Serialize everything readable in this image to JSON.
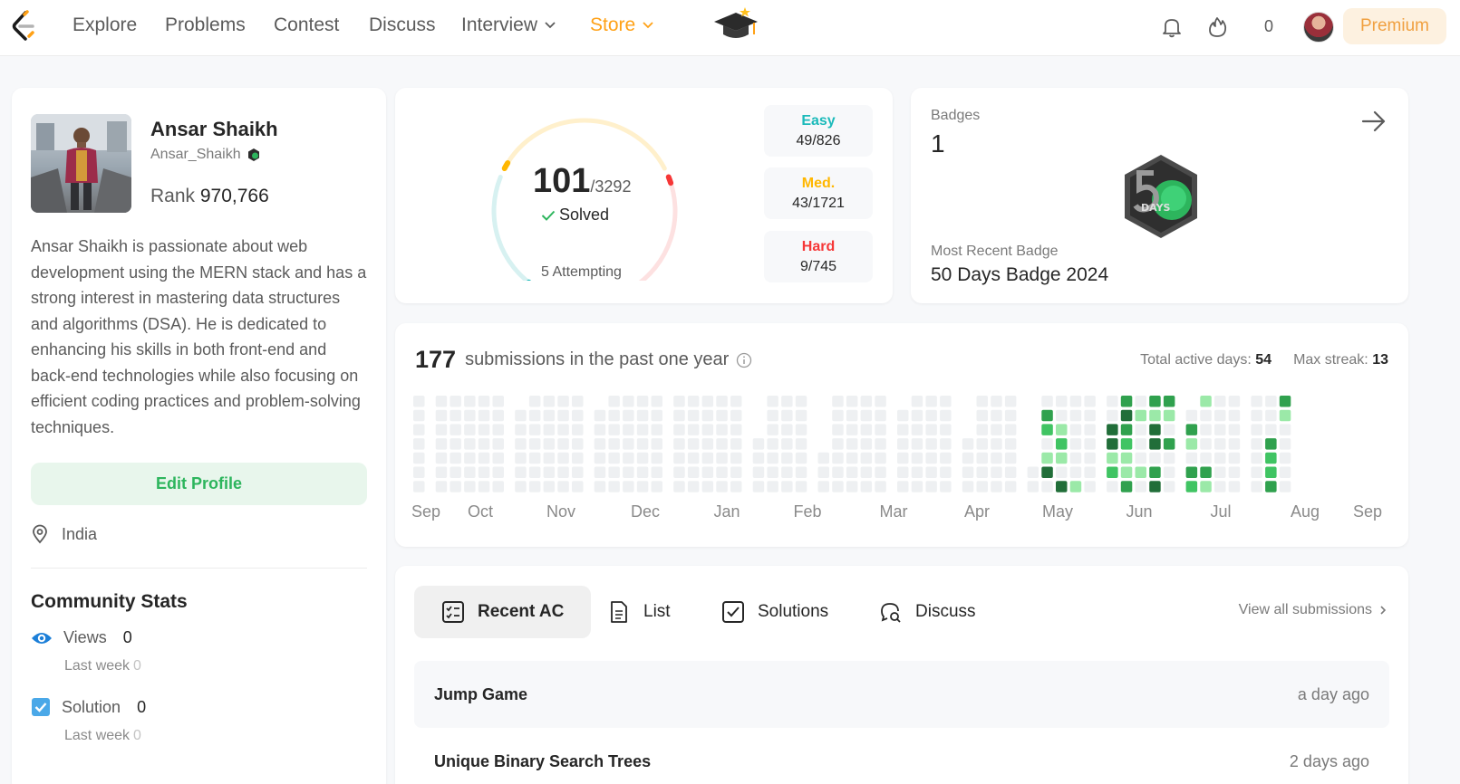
{
  "nav": {
    "items": [
      "Explore",
      "Problems",
      "Contest",
      "Discuss",
      "Interview",
      "Store"
    ],
    "streak": "0",
    "premium": "Premium"
  },
  "profile": {
    "name": "Ansar Shaikh",
    "username": "Ansar_Shaikh",
    "rank_label": "Rank",
    "rank": "970,766",
    "bio": "Ansar Shaikh is passionate about web development using the MERN stack and has a strong interest in mastering data structures and algorithms (DSA). He is dedicated to enhancing his skills in both front-end and back-end technologies while also focusing on efficient coding practices and problem-solving techniques.",
    "edit": "Edit Profile",
    "location": "India"
  },
  "community": {
    "title": "Community Stats",
    "views_label": "Views",
    "views": "0",
    "views_week_label": "Last week",
    "views_week": "0",
    "solution_label": "Solution",
    "solution": "0",
    "solution_week_label": "Last week",
    "solution_week": "0"
  },
  "solved": {
    "count": "101",
    "total": "/3292",
    "label": "Solved",
    "attempting": "5 Attempting",
    "easy_label": "Easy",
    "easy": "49/826",
    "med_label": "Med.",
    "med": "43/1721",
    "hard_label": "Hard",
    "hard": "9/745",
    "easy_solved": 49,
    "med_solved": 43,
    "hard_solved": 9,
    "colors": {
      "easy": "#1cbaba",
      "med": "#ffb700",
      "hard": "#f63737"
    }
  },
  "badges": {
    "title": "Badges",
    "count": "1",
    "badge_text": "DAYS",
    "recent_label": "Most Recent Badge",
    "recent_name": "50 Days Badge 2024"
  },
  "heatmap": {
    "count": "177",
    "text": "submissions in the past one year",
    "active_label": "Total active days:",
    "active": "54",
    "streak_label": "Max streak:",
    "streak": "13",
    "months": [
      "Sep",
      "Oct",
      "Nov",
      "Dec",
      "Jan",
      "Feb",
      "Mar",
      "Apr",
      "May",
      "Jun",
      "Jul",
      "Aug",
      "Sep"
    ]
  },
  "tabs": {
    "recent": "Recent AC",
    "list": "List",
    "solutions": "Solutions",
    "discuss": "Discuss",
    "view_all": "View all submissions"
  },
  "submissions": [
    {
      "title": "Jump Game",
      "time": "a day ago"
    },
    {
      "title": "Unique Binary Search Trees",
      "time": "2 days ago"
    }
  ]
}
